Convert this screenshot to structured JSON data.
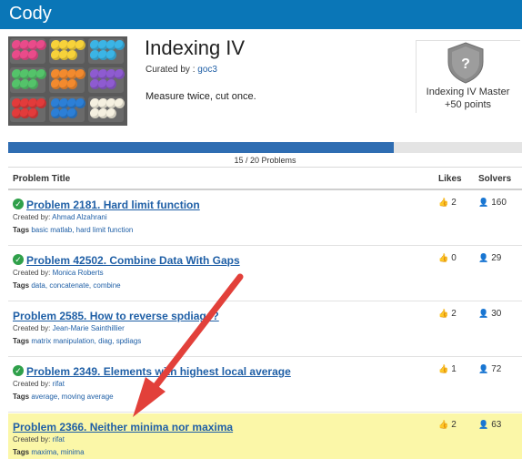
{
  "app": {
    "brand": "Cody"
  },
  "group": {
    "title": "Indexing IV",
    "curated_prefix": "Curated by :",
    "curator": "goc3",
    "tagline": "Measure twice, cut once."
  },
  "badge": {
    "icon": "shield-question-icon",
    "name": "Indexing IV Master",
    "points": "+50 points"
  },
  "progress": {
    "text": "15 / 20 Problems",
    "completed": 15,
    "total": 20,
    "fill_color": "#2f6db2"
  },
  "table": {
    "headers": {
      "title": "Problem Title",
      "likes": "Likes",
      "solvers": "Solvers"
    },
    "rows": [
      {
        "title": "Problem 2181. Hard limit function",
        "solved": true,
        "created_label": "Created by:",
        "author": "Ahmad Alzahrani",
        "tags_label": "Tags",
        "tags": "basic matlab, hard limit function",
        "likes": "2",
        "solvers": "160"
      },
      {
        "title": "Problem 42502. Combine Data With Gaps",
        "solved": true,
        "created_label": "Created by:",
        "author": "Monica Roberts",
        "tags_label": "Tags",
        "tags": "data, concatenate, combine",
        "likes": "0",
        "solvers": "29"
      },
      {
        "title": "Problem 2585. How to reverse spdiags?",
        "solved": false,
        "created_label": "Created by:",
        "author": "Jean-Marie Sainthillier",
        "tags_label": "Tags",
        "tags": "matrix manipulation, diag, spdiags",
        "likes": "2",
        "solvers": "30"
      },
      {
        "title": "Problem 2349. Elements with highest local average",
        "solved": true,
        "created_label": "Created by:",
        "author": "rifat",
        "tags_label": "Tags",
        "tags": "average, moving average",
        "likes": "1",
        "solvers": "72"
      },
      {
        "title": "Problem 2366. Neither minima nor maxima",
        "solved": false,
        "highlighted": true,
        "created_label": "Created by:",
        "author": "rifat",
        "tags_label": "Tags",
        "tags": "maxima, minima",
        "likes": "2",
        "solvers": "63"
      }
    ]
  },
  "colors": {
    "brand_bar": "#0a76b7",
    "link": "#1f5fa6",
    "solved_check": "#2fa04a",
    "highlight_row": "#fbf7a8",
    "annotation_arrow": "#e2403a"
  }
}
